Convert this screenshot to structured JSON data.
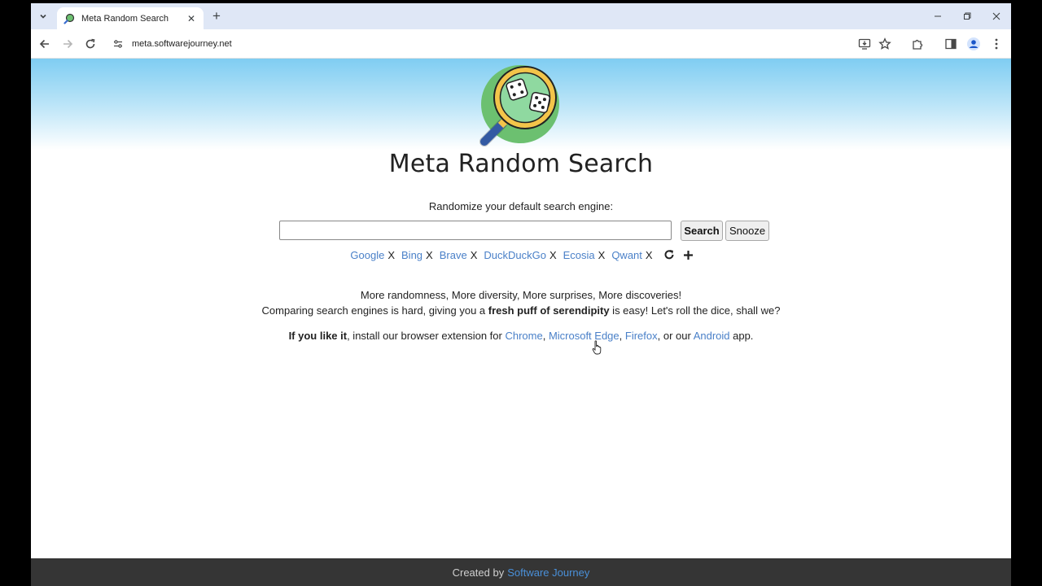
{
  "browser": {
    "tab_title": "Meta Random Search",
    "url": "meta.softwarejourney.net"
  },
  "page": {
    "title": "Meta Random Search",
    "subtitle": "Randomize your default search engine:",
    "search_input_value": "",
    "search_button": "Search",
    "snooze_button": "Snooze",
    "engines": [
      {
        "name": "Google",
        "remove": "X"
      },
      {
        "name": "Bing",
        "remove": "X"
      },
      {
        "name": "Brave",
        "remove": "X"
      },
      {
        "name": "DuckDuckGo",
        "remove": "X"
      },
      {
        "name": "Ecosia",
        "remove": "X"
      },
      {
        "name": "Qwant",
        "remove": "X"
      }
    ],
    "tagline_1": "More randomness, More diversity, More surprises, More discoveries!",
    "tagline_2_pre": "Comparing search engines is hard, giving you a ",
    "tagline_2_bold": "fresh puff of serendipity",
    "tagline_2_post": " is easy! Let's roll the dice, shall we?",
    "ext_bold": "If you like it",
    "ext_text": ", install our browser extension for ",
    "ext_chrome": "Chrome",
    "ext_sep1": ", ",
    "ext_edge": "Microsoft Edge",
    "ext_sep2": ", ",
    "ext_firefox": "Firefox",
    "ext_sep3": ", or our ",
    "ext_android": "Android",
    "ext_end": " app."
  },
  "footer": {
    "created_by": "Created by",
    "author": "Software Journey"
  },
  "colors": {
    "link": "#4a80c8",
    "footer_bg": "#353535",
    "sky": "#7fcdf2"
  }
}
